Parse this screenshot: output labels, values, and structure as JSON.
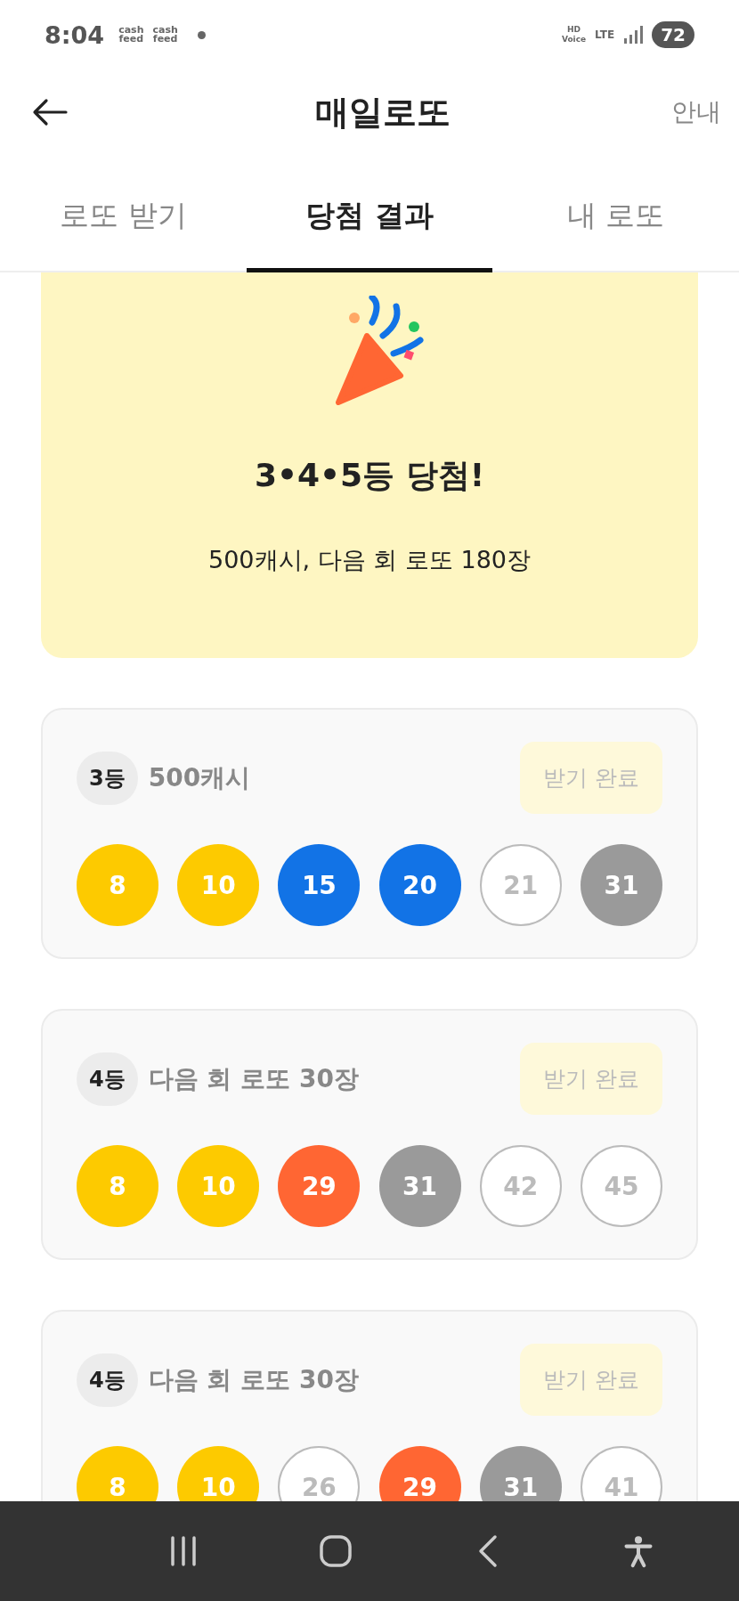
{
  "status_bar": {
    "time": "8:04",
    "notification_labels": [
      "cash\nfeed",
      "cash\nfeed"
    ],
    "network": "LTE",
    "voice": "HD\nVoice",
    "battery": "72"
  },
  "header": {
    "title": "매일로또",
    "action": "안내"
  },
  "tabs": [
    {
      "label": "로또 받기",
      "selected": false
    },
    {
      "label": "당첨 결과",
      "selected": true
    },
    {
      "label": "내 로또",
      "selected": false
    }
  ],
  "banner": {
    "title": "3•4•5등 당첨!",
    "subtitle": "500캐시, 다음 회 로또 180장"
  },
  "prizes": [
    {
      "rank": "3등",
      "reward": "500캐시",
      "button": "받기 완료",
      "balls": [
        {
          "number": "8",
          "color": "#fdca00"
        },
        {
          "number": "10",
          "color": "#fdca00"
        },
        {
          "number": "15",
          "color": "#1273e6"
        },
        {
          "number": "20",
          "color": "#1273e6"
        },
        {
          "number": "21",
          "color": "#ffffff"
        },
        {
          "number": "31",
          "color": "#9a9a9a"
        }
      ]
    },
    {
      "rank": "4등",
      "reward": "다음 회 로또 30장",
      "button": "받기 완료",
      "balls": [
        {
          "number": "8",
          "color": "#fdca00"
        },
        {
          "number": "10",
          "color": "#fdca00"
        },
        {
          "number": "29",
          "color": "#ff6633"
        },
        {
          "number": "31",
          "color": "#9a9a9a"
        },
        {
          "number": "42",
          "color": "#ffffff"
        },
        {
          "number": "45",
          "color": "#ffffff"
        }
      ]
    },
    {
      "rank": "4등",
      "reward": "다음 회 로또 30장",
      "button": "받기 완료",
      "balls": [
        {
          "number": "8",
          "color": "#fdca00"
        },
        {
          "number": "10",
          "color": "#fdca00"
        },
        {
          "number": "26",
          "color": "#ffffff"
        },
        {
          "number": "29",
          "color": "#ff6633"
        },
        {
          "number": "31",
          "color": "#9a9a9a"
        },
        {
          "number": "41",
          "color": "#ffffff"
        }
      ]
    }
  ]
}
